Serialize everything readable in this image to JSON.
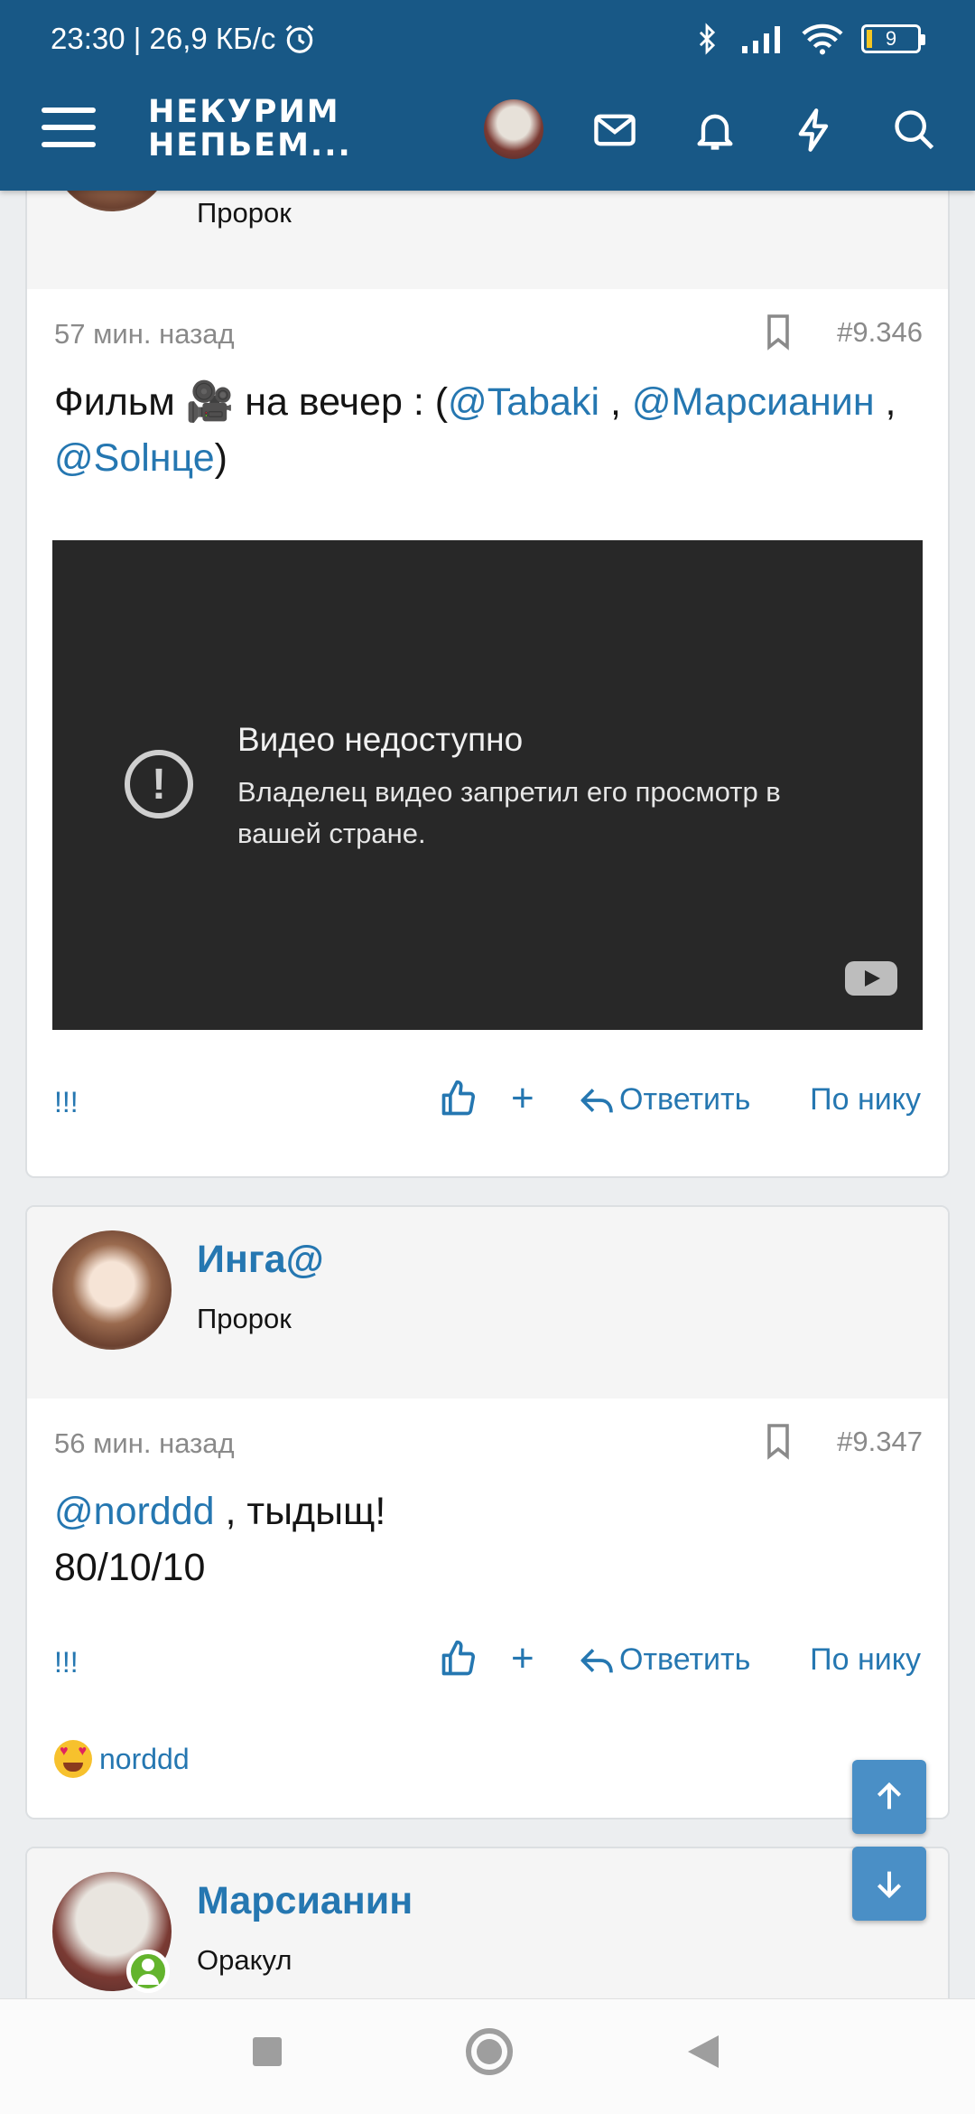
{
  "status_bar": {
    "time_speed": "23:30 | 26,9 КБ/с",
    "battery": "9"
  },
  "header": {
    "logo_line1": "НЕКУРИМ",
    "logo_line2": "НЕПЬЕМ..."
  },
  "top_post": {
    "rank": "Пророк"
  },
  "post1": {
    "time": "57 мин. назад",
    "number": "#9.346",
    "text_prefix": "Фильм 🎥 на вечер : (",
    "mention1": "@Tabaki",
    "sep1": " , ",
    "mention2": "@Марсианин",
    "sep2": " , ",
    "mention3": "@Solнце",
    "text_suffix": ")",
    "video": {
      "title": "Видео недоступно",
      "subtitle": "Владелец видео запретил его просмотр в вашей стране."
    }
  },
  "post2": {
    "author": "Инга@",
    "rank": "Пророк",
    "time": "56 мин. назад",
    "number": "#9.347",
    "mention": "@norddd",
    "text": " , тыдыщ!",
    "line2": "80/10/10",
    "reaction_user": "norddd"
  },
  "post3": {
    "author": "Марсианин",
    "rank": "Оракул"
  },
  "actions": {
    "report": "!!!",
    "plus": "+",
    "reply": "Ответить",
    "by_nick": "По нику"
  },
  "icons": [
    "menu-icon",
    "mail-icon",
    "bell-icon",
    "lightning-icon",
    "search-icon",
    "bookmark-icon",
    "thumbs-up-icon",
    "reply-icon",
    "arrow-up-icon",
    "arrow-down-icon",
    "youtube-icon"
  ],
  "colors": {
    "header": "#185886",
    "accent": "#2577b1",
    "video_bg": "#282828"
  }
}
